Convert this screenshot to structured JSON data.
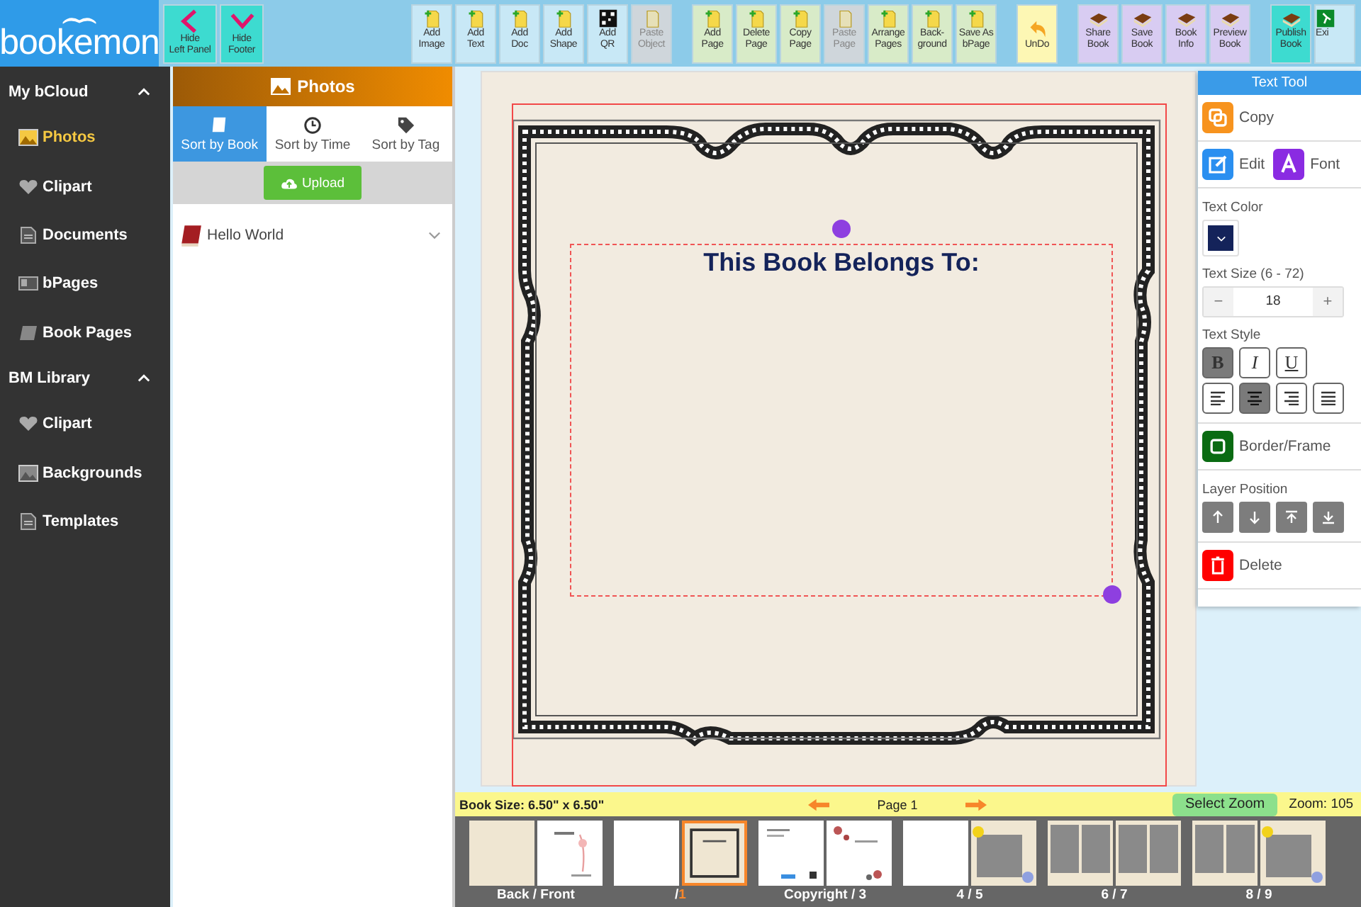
{
  "logo": {
    "text": "bookemon"
  },
  "toolbar": [
    {
      "kind": "hide",
      "buttons": [
        {
          "label": "Hide\nLeft Panel",
          "disabled": false
        },
        {
          "label": "Hide\nFooter",
          "disabled": false
        }
      ]
    },
    {
      "kind": "add",
      "buttons": [
        {
          "label": "Add\nImage",
          "disabled": false
        },
        {
          "label": "Add\nText",
          "disabled": false
        },
        {
          "label": "Add\nDoc",
          "disabled": false
        },
        {
          "label": "Add\nShape",
          "disabled": false
        },
        {
          "label": "Add\nQR",
          "disabled": false
        },
        {
          "label": "Paste\nObject",
          "disabled": true
        }
      ]
    },
    {
      "kind": "page",
      "buttons": [
        {
          "label": "Add\nPage",
          "disabled": false
        },
        {
          "label": "Delete\nPage",
          "disabled": false
        },
        {
          "label": "Copy\nPage",
          "disabled": false
        },
        {
          "label": "Paste\nPage",
          "disabled": true
        },
        {
          "label": "Arrange\nPages",
          "disabled": false
        },
        {
          "label": "Back-\nground",
          "disabled": false
        },
        {
          "label": "Save As\nbPage",
          "disabled": false
        }
      ]
    },
    {
      "kind": "undo",
      "buttons": [
        {
          "label": "UnDo",
          "disabled": false
        }
      ]
    },
    {
      "kind": "book",
      "buttons": [
        {
          "label": "Share\nBook",
          "disabled": false
        },
        {
          "label": "Save\nBook",
          "disabled": false
        },
        {
          "label": "Book\nInfo",
          "disabled": false
        },
        {
          "label": "Preview\nBook",
          "disabled": false
        }
      ]
    },
    {
      "kind": "publish",
      "buttons": [
        {
          "label": "Publish\nBook",
          "disabled": false
        }
      ]
    },
    {
      "kind": "exit",
      "buttons": [
        {
          "label": "Exi",
          "disabled": false
        }
      ]
    }
  ],
  "sidebar": {
    "sections": [
      {
        "title": "My bCloud",
        "expanded": true,
        "items": [
          {
            "label": "Photos",
            "selected": true
          },
          {
            "label": "Clipart",
            "selected": false
          },
          {
            "label": "Documents",
            "selected": false
          },
          {
            "label": "bPages",
            "selected": false
          },
          {
            "label": "Book Pages",
            "selected": false
          }
        ]
      },
      {
        "title": "BM Library",
        "expanded": true,
        "items": [
          {
            "label": "Clipart",
            "selected": false
          },
          {
            "label": "Backgrounds",
            "selected": false
          },
          {
            "label": "Templates",
            "selected": false
          }
        ]
      }
    ]
  },
  "panel": {
    "title": "Photos",
    "tabs": [
      {
        "label": "Sort by Book",
        "selected": true
      },
      {
        "label": "Sort by Time",
        "selected": false
      },
      {
        "label": "Sort by Tag",
        "selected": false
      }
    ],
    "upload": "Upload",
    "items": [
      {
        "label": "Hello World",
        "expanded": false
      }
    ]
  },
  "canvas": {
    "text": "This Book Belongs To:",
    "color": "#14235a"
  },
  "text_tool": {
    "title": "Text Tool",
    "copy": "Copy",
    "edit": "Edit",
    "font": "Font",
    "color_label": "Text Color",
    "size_label": "Text Size (6 - 72)",
    "minus": "−",
    "size": "18",
    "plus": "+",
    "style_label": "Text Style",
    "styles": [
      {
        "label": "B",
        "selected": true
      },
      {
        "label": "I",
        "selected": false
      },
      {
        "label": "U",
        "selected": false
      }
    ],
    "aligns": [
      {
        "kind": "left",
        "selected": false
      },
      {
        "kind": "center",
        "selected": true
      },
      {
        "kind": "right",
        "selected": false
      },
      {
        "kind": "justify",
        "selected": false
      }
    ],
    "border": "Border/Frame",
    "layer_label": "Layer Position",
    "delete": "Delete"
  },
  "footer": {
    "book_size": "Book Size: 6.50\" x 6.50\"",
    "page": "Page 1",
    "zoom_button": "Select Zoom",
    "zoom": "Zoom: 105",
    "spreads": [
      {
        "label": "Back / Front",
        "pages": [
          {
            "kind": "beige",
            "selected": false
          },
          {
            "kind": "title",
            "selected": false
          }
        ]
      },
      {
        "label": "/",
        "current": "1",
        "pages": [
          {
            "kind": "white",
            "selected": false
          },
          {
            "kind": "frame",
            "selected": true
          }
        ]
      },
      {
        "label": "Copyright / 3",
        "pages": [
          {
            "kind": "text",
            "selected": false
          },
          {
            "kind": "floral",
            "selected": false
          }
        ]
      },
      {
        "label": "4 / 5",
        "pages": [
          {
            "kind": "white",
            "selected": false
          },
          {
            "kind": "photo",
            "selected": false
          }
        ]
      },
      {
        "label": "6 / 7",
        "pages": [
          {
            "kind": "grid",
            "selected": false
          },
          {
            "kind": "grid",
            "selected": false
          }
        ]
      },
      {
        "label": "8 / 9",
        "pages": [
          {
            "kind": "grid",
            "selected": false
          },
          {
            "kind": "photo",
            "selected": false
          }
        ]
      }
    ]
  }
}
